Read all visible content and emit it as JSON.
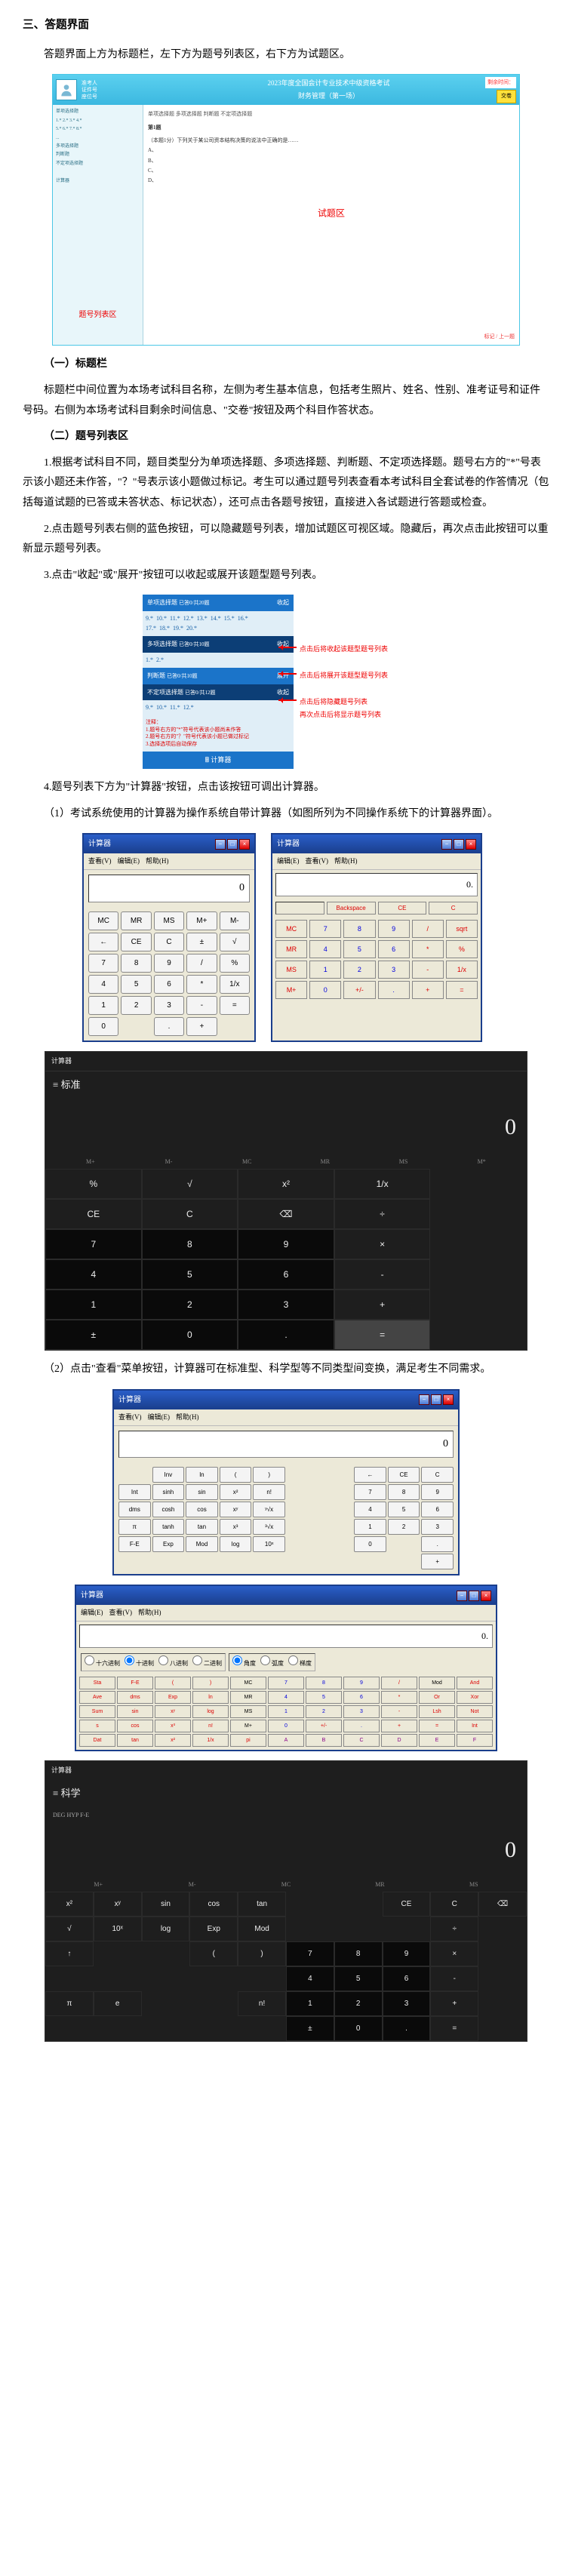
{
  "section_title": "三、答题界面",
  "intro": "答题界面上方为标题栏，左下方为题号列表区，右下方为试题区。",
  "fig1": {
    "exam_title": "2023年度全国会计专业技术中级资格考试\n财务管理（第一场）",
    "candidate": {
      "name": "准考人",
      "id_label": "证件号",
      "seat_label": "座位号"
    },
    "countdown": "剩余时间：",
    "submit": "交卷",
    "left_label": "题号列表区",
    "right_label": "试题区",
    "tabs": "单项选择题  多项选择题  判断题  不定项选择题",
    "q_stem": "第1题",
    "q_text": "（本题1分）下列关于某公司资本结构决策的说法中正确的是……",
    "q_opts": [
      "A、",
      "B、",
      "C、",
      "D、"
    ],
    "foot": "标记 / 上一题"
  },
  "sub1": "（一）标题栏",
  "sub1_p": "标题栏中间位置为本场考试科目名称，左侧为考生基本信息，包括考生照片、姓名、性别、准考证号和证件号码。右侧为本场考试科目剩余时间信息、\"交卷\"按钮及两个科目作答状态。",
  "sub2": "（二）题号列表区",
  "p1": "1.根据考试科目不同，题目类型分为单项选择题、多项选择题、判断题、不定项选择题。题号右方的\"*\"号表示该小题还未作答，\"？\"号表示该小题做过标记。考生可以通过题号列表查看本考试科目全套试卷的作答情况（包括每道试题的已答或未答状态、标记状态），还可点击各题号按钮，直接进入各试题进行答题或检查。",
  "p2": "2.点击题号列表右侧的蓝色按钮，可以隐藏题号列表，增加试题区可视区域。隐藏后，再次点击此按钮可以重新显示题号列表。",
  "p3": "3.点击\"收起\"或\"展开\"按钮可以收起或展开该题型题号列表。",
  "fig2": {
    "h1": "单项选择题",
    "h1_sub": "已答0/共20题",
    "grid1": "9.* 10.* 11.* 12.* 13.* 14.* 15.* 16.*\n17.* 18.* 19.* 20.*",
    "h2": "多项选择题",
    "h2_sub": "已答0/共10题",
    "h2_arrow": "收起",
    "grid2": "1.* 2.*",
    "h3": "判断题",
    "h3_sub": "已答0/共10题",
    "h3_arrow": "展开",
    "h4": "不定项选择题",
    "h4_sub": "已答0/共12题",
    "grid4": "9.* 10.* 11.* 12.*",
    "note": "注释：\n1.题号右方的\"*\"符号代表该小题尚未作答\n2.题号右方的\"？\"符号代表该小题已做过标记\n3.选择选项后自动保存",
    "calc": "计算器",
    "lab1": "点击后将收起该题型题号列表",
    "lab2": "点击后将展开该题型题号列表",
    "lab3": "点击后将隐藏题号列表\n再次点击后将显示题号列表"
  },
  "p4": "4.题号列表下方为\"计算器\"按钮，点击该按钮可调出计算器。",
  "p5": "（1）考试系统使用的计算器为操作系统自带计算器（如图所列为不同操作系统下的计算器界面）。",
  "fig3": {
    "a": {
      "title": "计算器",
      "menu": [
        "查看(V)",
        "编辑(E)",
        "帮助(H)"
      ],
      "disp": "0",
      "keys": [
        "MC",
        "MR",
        "MS",
        "M+",
        "M-",
        "←",
        "CE",
        "C",
        "±",
        "√",
        "7",
        "8",
        "9",
        "/",
        "%",
        "4",
        "5",
        "6",
        "*",
        "1/x",
        "1",
        "2",
        "3",
        "-",
        "=",
        "0",
        "",
        ".",
        "+",
        ""
      ]
    },
    "b": {
      "title": "计算器",
      "menu": [
        "编辑(E)",
        "查看(V)",
        "帮助(H)"
      ],
      "disp": "0.",
      "row1": [
        "",
        "Backspace",
        "CE",
        "C"
      ],
      "keys": [
        "MC",
        "7",
        "8",
        "9",
        "/",
        "sqrt",
        "MR",
        "4",
        "5",
        "6",
        "*",
        "%",
        "MS",
        "1",
        "2",
        "3",
        "-",
        "1/x",
        "M+",
        "0",
        "+/-",
        ".",
        "+",
        "="
      ]
    }
  },
  "fig4": {
    "title": "计算器",
    "mode": "标准",
    "disp": "0",
    "mem": [
      "M+",
      "M-",
      "MC",
      "MR",
      "MS",
      "M*"
    ],
    "keys": [
      "%",
      "√",
      "x²",
      "1/x",
      "",
      "CE",
      "C",
      "⌫",
      "÷",
      "",
      "7",
      "8",
      "9",
      "×",
      "",
      "4",
      "5",
      "6",
      "-",
      "",
      "1",
      "2",
      "3",
      "+",
      "",
      "±",
      "0",
      ".",
      "=",
      ""
    ]
  },
  "p6": "（2）点击\"查看\"菜单按钮，计算器可在标准型、科学型等不同类型间变换，满足考生不同需求。",
  "fig5": {
    "title": "计算器",
    "menu": [
      "查看(V)",
      "编辑(E)",
      "帮助(H)"
    ],
    "disp": "0",
    "keys": [
      "",
      "Inv",
      "ln",
      "(",
      ")",
      "",
      "",
      "←",
      "CE",
      "C",
      "Int",
      "sinh",
      "sin",
      "x²",
      "n!",
      "",
      "",
      "7",
      "8",
      "9",
      "dms",
      "cosh",
      "cos",
      "xʸ",
      "ʸ√x",
      "",
      "",
      "4",
      "5",
      "6",
      "π",
      "tanh",
      "tan",
      "x³",
      "³√x",
      "",
      "",
      "1",
      "2",
      "3",
      "F-E",
      "Exp",
      "Mod",
      "log",
      "10ˣ",
      "",
      "",
      "0",
      "",
      ".",
      "",
      "",
      "",
      "",
      "",
      "",
      "",
      "",
      "",
      "+"
    ]
  },
  "fig6": {
    "title": "计算器",
    "menu": [
      "编辑(E)",
      "查看(V)",
      "帮助(H)"
    ],
    "disp": "0.",
    "radios1": [
      "十六进制",
      "十进制",
      "八进制",
      "二进制"
    ],
    "radios2": [
      "角度",
      "弧度",
      "梯度"
    ],
    "keys": [
      "Sta",
      "F-E",
      "(",
      ")",
      "MC",
      "7",
      "8",
      "9",
      "/",
      "Mod",
      "And",
      "Ave",
      "dms",
      "Exp",
      "ln",
      "MR",
      "4",
      "5",
      "6",
      "*",
      "Or",
      "Xor",
      "Sum",
      "sin",
      "xʸ",
      "log",
      "MS",
      "1",
      "2",
      "3",
      "-",
      "Lsh",
      "Not",
      "s",
      "cos",
      "x³",
      "n!",
      "M+",
      "0",
      "+/-",
      ".",
      "+",
      "=",
      "Int",
      "Dat",
      "tan",
      "x²",
      "1/x",
      "pi",
      "A",
      "B",
      "C",
      "D",
      "E",
      "F"
    ]
  },
  "fig7": {
    "title": "计算器",
    "mode": "科学",
    "disp": "0",
    "ang": "DEG    HYP    F-E",
    "mem": [
      "M+",
      "M-",
      "MC",
      "MR",
      "MS"
    ],
    "keys": [
      "x²",
      "xʸ",
      "sin",
      "cos",
      "tan",
      "",
      "",
      "CE",
      "C",
      "⌫",
      "√",
      "10ˣ",
      "log",
      "Exp",
      "Mod",
      "",
      "",
      "",
      "÷",
      "",
      "↑",
      "",
      "",
      "(",
      ")",
      "7",
      "8",
      "9",
      "×",
      "",
      "",
      "",
      "",
      "",
      "",
      "4",
      "5",
      "6",
      "-",
      "",
      "π",
      "e",
      "",
      "",
      "n!",
      "1",
      "2",
      "3",
      "+",
      "",
      "",
      "",
      "",
      "",
      "",
      "±",
      "0",
      ".",
      "=",
      ""
    ]
  }
}
